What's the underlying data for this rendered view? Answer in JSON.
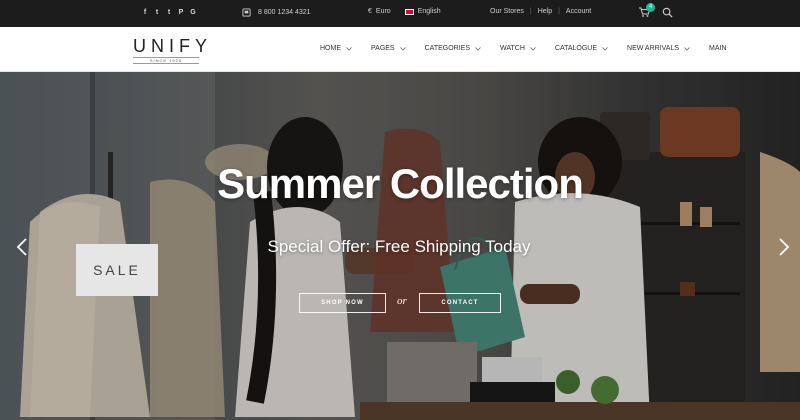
{
  "topbar": {
    "social": [
      {
        "name": "facebook-icon",
        "glyph": "f"
      },
      {
        "name": "twitter-icon",
        "glyph": "t"
      },
      {
        "name": "tumblr-icon",
        "glyph": "t"
      },
      {
        "name": "pinterest-icon",
        "glyph": "P"
      },
      {
        "name": "google-icon",
        "glyph": "G"
      }
    ],
    "phone": "8 800 1234 4321",
    "currency": "Euro",
    "currency_symbol": "€",
    "language": "English",
    "links": [
      "Our Stores",
      "Help",
      "Account"
    ],
    "cart_count": "4",
    "accent": "#18ba9b"
  },
  "header": {
    "logo": "UNIFY",
    "logo_tag": "SINCE 1926",
    "nav": [
      {
        "label": "HOME",
        "has_dropdown": true
      },
      {
        "label": "PAGES",
        "has_dropdown": true
      },
      {
        "label": "CATEGORIES",
        "has_dropdown": true
      },
      {
        "label": "WATCH",
        "has_dropdown": true
      },
      {
        "label": "CATALOGUE",
        "has_dropdown": true
      },
      {
        "label": "NEW ARRIVALS",
        "has_dropdown": true
      },
      {
        "label": "MAIN",
        "has_dropdown": false
      }
    ]
  },
  "hero": {
    "title": "Summer Collection",
    "subtitle": "Special Offer: Free Shipping Today",
    "shop_button": "SHOP NOW",
    "separator": "or",
    "contact_button": "CONTACT",
    "sign": "SALE"
  }
}
